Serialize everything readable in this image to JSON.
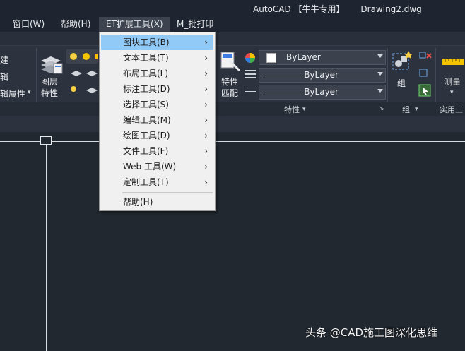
{
  "window": {
    "title": "AutoCAD 【牛牛专用】      Drawing2.dwg"
  },
  "menubar": {
    "items": [
      {
        "label": "窗口(W)"
      },
      {
        "label": "帮助(H)"
      },
      {
        "label": "ET扩展工具(X)"
      },
      {
        "label": "M_批打印"
      }
    ]
  },
  "ribbon": {
    "left_fragments": [
      "建",
      "辑",
      "辑属性"
    ],
    "layer_props_button": {
      "line1": "图层",
      "line2": "特性"
    },
    "match_props_button": {
      "line1": "特性",
      "line2": "匹配"
    },
    "combos": [
      {
        "value": "ByLayer"
      },
      {
        "value": "ByLayer"
      },
      {
        "value": "ByLayer"
      }
    ],
    "group_button": {
      "label": "组"
    },
    "measure_button": {
      "label": "测量"
    },
    "panel_titles": {
      "properties": "特性",
      "groups": "组",
      "utilities": "实用工"
    }
  },
  "dropdown": {
    "items": [
      {
        "label": "图块工具(B)",
        "submenu": true,
        "highlighted": true
      },
      {
        "label": "文本工具(T)",
        "submenu": true
      },
      {
        "label": "布局工具(L)",
        "submenu": true
      },
      {
        "label": "标注工具(D)",
        "submenu": true
      },
      {
        "label": "选择工具(S)",
        "submenu": true
      },
      {
        "label": "编辑工具(M)",
        "submenu": true
      },
      {
        "label": "绘图工具(D)",
        "submenu": true
      },
      {
        "label": "文件工具(F)",
        "submenu": true
      },
      {
        "label": "Web 工具(W)",
        "submenu": true
      },
      {
        "label": "定制工具(T)",
        "submenu": true
      }
    ],
    "help": {
      "label": "帮助(H)"
    },
    "chevron": "›"
  },
  "watermark": "头条 @CAD施工图深化思维",
  "colors": {
    "highlight": "#91c9f7",
    "background": "#212830",
    "ribbon": "#2d333e"
  }
}
